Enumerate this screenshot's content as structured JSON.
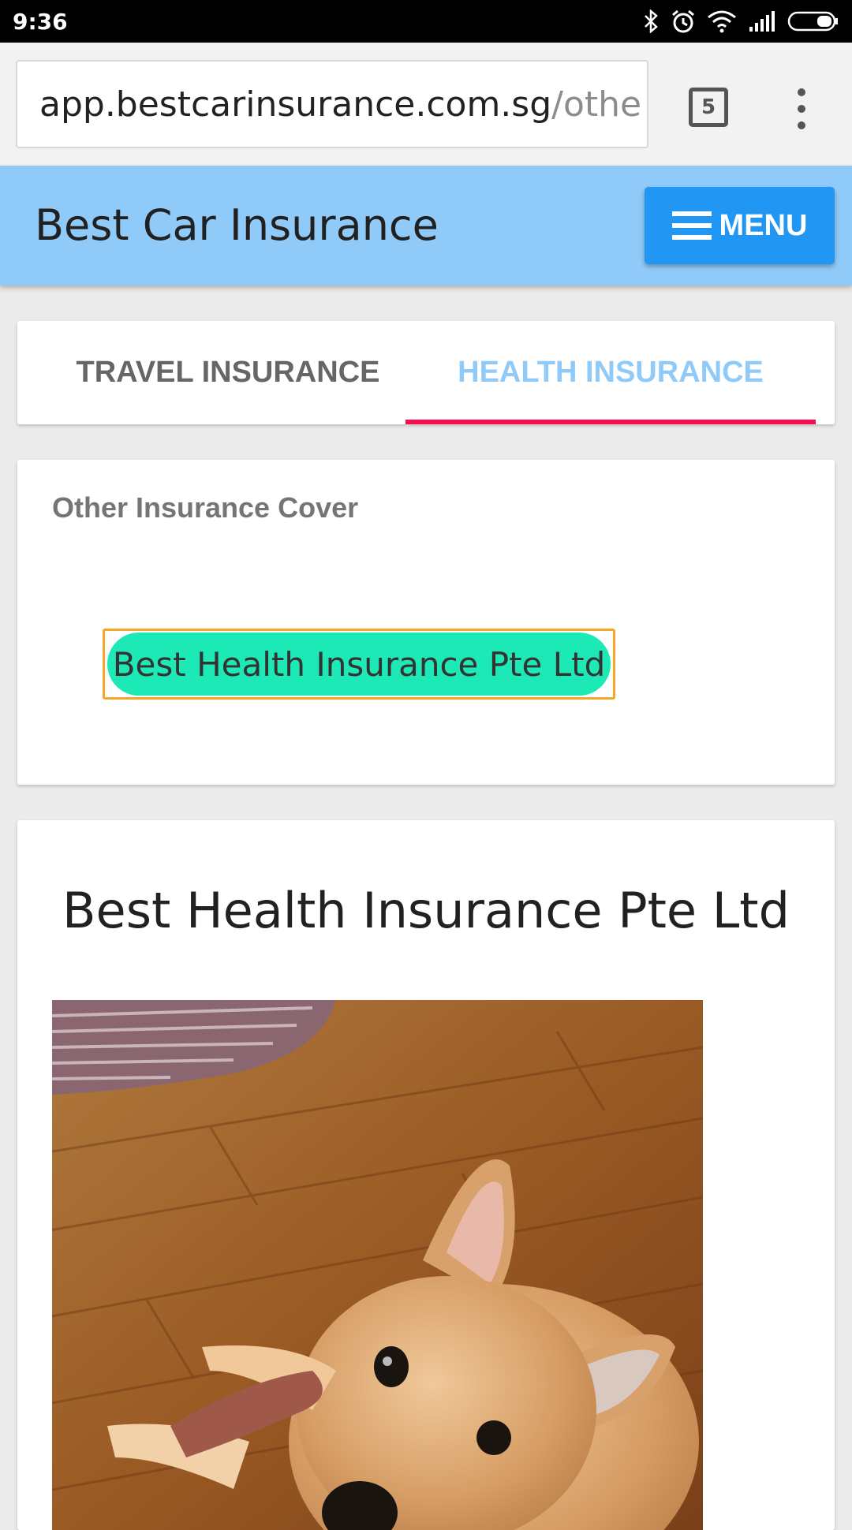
{
  "status_bar": {
    "time": "9:36",
    "icons": [
      "bluetooth-icon",
      "alarm-icon",
      "wifi-icon",
      "signal-icon",
      "battery-icon"
    ]
  },
  "browser": {
    "url_domain": "app.bestcarinsurance.com.sg",
    "url_path": "/othe",
    "tab_count": "5"
  },
  "header": {
    "title": "Best Car Insurance",
    "menu_label": "MENU",
    "background_color": "#90caf9",
    "menu_color": "#2196f3"
  },
  "tabs": [
    {
      "label": "TRAVEL INSURANCE",
      "active": false
    },
    {
      "label": "HEALTH INSURANCE",
      "active": true
    }
  ],
  "cover": {
    "heading": "Other Insurance Cover",
    "chip_label": "Best Health Insurance Pte Ltd",
    "chip_color": "#1de9b6"
  },
  "company": {
    "title": "Best Health Insurance Pte Ltd",
    "photo": "puppy-on-wooden-floor"
  },
  "colors": {
    "tab_indicator": "#f50f52",
    "active_tab_text": "#90caf9"
  }
}
